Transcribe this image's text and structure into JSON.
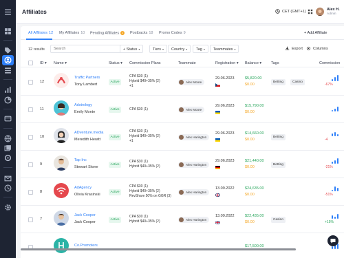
{
  "header": {
    "title": "Affiliates",
    "timezone": "CET (GMT+1)",
    "user_name": "Alex H.",
    "user_role": "Admin"
  },
  "tabs": [
    {
      "label": "All Affiliates",
      "count": "12"
    },
    {
      "label": "My Affiliates",
      "count": "10"
    },
    {
      "label": "Pending Affiliates",
      "count": "2"
    },
    {
      "label": "Postbacks",
      "count": "18"
    },
    {
      "label": "Promo Codes",
      "count": "9"
    }
  ],
  "add_button_label": "Add Affiliate",
  "toolbar": {
    "results": "12 results",
    "search_placeholder": "Search",
    "filters": [
      "Status",
      "Tiers",
      "Country",
      "Tag",
      "Teammates"
    ],
    "export_label": "Export",
    "columns_label": "Columns"
  },
  "columns": [
    "ID",
    "Name",
    "Status",
    "Commission Plans",
    "Teammate",
    "Registration",
    "Balance",
    "Tags",
    "Commission"
  ],
  "rows": [
    {
      "id": "12",
      "company": "Traffic Partners",
      "person": "Tony Lambert",
      "status": "Active",
      "plans": [
        "CPA $30 (1)",
        "Hybrid $40+35% (2)",
        "+1"
      ],
      "teammate": "Alex Moore",
      "date": "29.06.2023",
      "flag": "cz",
      "balance_green": "$5,820.00",
      "balance_orange": "$0.00",
      "tags": [
        "Betting",
        "Casino"
      ],
      "pct": "-67%",
      "pct_sign": "neg",
      "logo": "traffic"
    },
    {
      "id": "11",
      "company": "Adstrology",
      "person": "Emily Monte",
      "status": "Active",
      "plans": [
        "CPA $30 (1)"
      ],
      "teammate": "Alex Moore",
      "date": "29.06.2023",
      "flag": "ua",
      "balance_green": "$15,790.00",
      "balance_orange": "$0.00",
      "tags": [],
      "pct": "",
      "pct_sign": "",
      "logo": "woman1"
    },
    {
      "id": "10",
      "company": "ADventure.media",
      "person": "Meredith Hewitt",
      "status": "Active",
      "plans": [
        "CPA $30 (1)",
        "Hybrid $40+35% (2)",
        "+1"
      ],
      "teammate": "Alex Harington",
      "date": "29.06.2023",
      "flag": "ua",
      "balance_green": "$14,660.00",
      "balance_orange": "$0.00",
      "tags": [
        "Betting"
      ],
      "pct": "-4",
      "pct_sign": "neg",
      "logo": "woman2"
    },
    {
      "id": "9",
      "company": "Tap Inc",
      "person": "Stewart Stone",
      "status": "Active",
      "plans": [
        "CPA $30 (1)",
        "Hybrid $40+35% (2)"
      ],
      "teammate": "Alex Harington",
      "date": "29.06.2023",
      "flag": "de",
      "balance_green": "$21,440.00",
      "balance_orange": "$0.00",
      "tags": [
        "Betting"
      ],
      "pct": "-21%",
      "pct_sign": "neg",
      "logo": "man1"
    },
    {
      "id": "8",
      "company": "AdAgency",
      "person": "Olivia Krasinski",
      "status": "Active",
      "plans": [
        "CPA $30 (1)",
        "Hybrid $40+35% (2)",
        "RevShare 50% on GGR (3)"
      ],
      "teammate": "Alex Harington",
      "date": "13.09.2022",
      "flag": "gb",
      "balance_green": "$24,635.00",
      "balance_orange": "$0.00",
      "tags": [],
      "pct": "-51%",
      "pct_sign": "neg",
      "logo": "adagency"
    },
    {
      "id": "7",
      "company": "Jack Cooper",
      "person": "Jack Cooper",
      "status": "Active",
      "plans": [
        "CPA $30 (1)",
        "Hybrid $40+35% (2)"
      ],
      "teammate": "Alex Harington",
      "date": "13.09.2022",
      "flag": "gb",
      "balance_green": "$22,435.00",
      "balance_orange": "$0.00",
      "tags": [
        "Casino"
      ],
      "pct": "+15%",
      "pct_sign": "pos",
      "logo": "man2"
    },
    {
      "id": "",
      "company": "Co.Promoters",
      "person": "",
      "status": "",
      "plans": [],
      "teammate": "",
      "date": "",
      "flag": "",
      "balance_green": "$17,500.00",
      "balance_orange": "",
      "tags": [],
      "pct": "",
      "pct_sign": "",
      "logo": "copromo"
    }
  ],
  "colors": {
    "accent": "#2d7ff9",
    "sidebar": "#1e2433",
    "positive": "#27a55b",
    "negative": "#e5484d",
    "warning": "#f5a623"
  }
}
